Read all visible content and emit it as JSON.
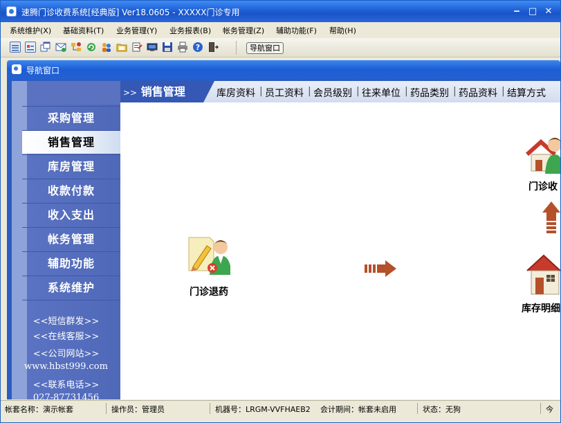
{
  "window": {
    "title": "速腾门诊收费系统[经典版] Ver18.0605  -  XXXXX门诊专用",
    "controls": [
      "‒",
      "□",
      "✕"
    ]
  },
  "menu": [
    "系统维护(X)",
    "基础资料(T)",
    "业务管理(Y)",
    "业务报表(B)",
    "帐务管理(Z)",
    "辅助功能(F)",
    "帮助(H)"
  ],
  "toolbar": {
    "icons": [
      "grid-icon",
      "card-icon",
      "windows-icon",
      "mail-icon",
      "tree-icon",
      "refresh-icon",
      "users-icon",
      "folder-icon",
      "note-icon",
      "monitor-icon",
      "save-icon",
      "print-icon",
      "help-icon",
      "exit-icon"
    ],
    "nav_button": "导航窗口"
  },
  "child_window": {
    "title": "导航窗口"
  },
  "sidebar": {
    "items": [
      "采购管理",
      "销售管理",
      "库房管理",
      "收款付款",
      "收入支出",
      "帐务管理",
      "辅助功能",
      "系统维护"
    ],
    "active_index": 1,
    "links": [
      "<<短信群发>>",
      "<<在线客服>>",
      "<<公司网站>>",
      "www.hbst999.com",
      "<<联系电话>>",
      "027-87731456"
    ]
  },
  "content": {
    "active_tab": "销售管理",
    "active_tab_prefix": ">>",
    "quick_links": [
      "库房资料",
      "员工资料",
      "会员级别",
      "往来单位",
      "药品类别",
      "药品资料",
      "结算方式"
    ],
    "flow": {
      "return_label": "门诊退药",
      "charge_label": "门诊收",
      "stock_label": "库存明细"
    }
  },
  "statusbar": {
    "account": "帐套名称：演示帐套",
    "operator": "操作员：管理员",
    "machine": "机器号：LRGM-VVFHAEB2",
    "period": "会计期间：帐套未启用",
    "state": "状态：无狗",
    "tail": "今"
  },
  "colors": {
    "title_blue": "#1e5fd6",
    "sidebar_blue": "#4f68b8",
    "tab_blue": "#3558b5",
    "arrow_brown": "#b4512a"
  }
}
